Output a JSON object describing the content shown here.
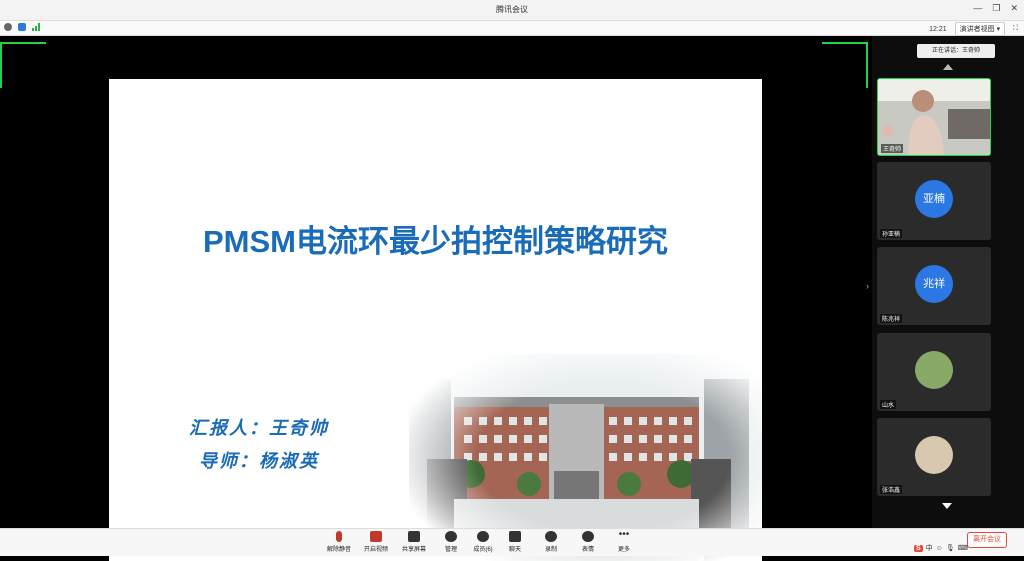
{
  "window": {
    "title": "腾讯会议"
  },
  "toolbar": {
    "time": "12:21",
    "view_label": "演讲者视图"
  },
  "slide": {
    "title": "PMSM电流环最少拍控制策略研究",
    "reporter": "汇报人：王奇帅",
    "advisor": "导师：杨淑英"
  },
  "sidebar": {
    "header": "正在讲话：王奇帅",
    "tiles": [
      {
        "name": "王奇帅",
        "avatar_text": ""
      },
      {
        "name": "孙亚楠",
        "avatar_text": "亚楠"
      },
      {
        "name": "陈兆祥",
        "avatar_text": "兆祥"
      },
      {
        "name": "山水",
        "avatar_text": ""
      },
      {
        "name": "张浩鑫",
        "avatar_text": ""
      }
    ]
  },
  "bottombar": {
    "buttons": [
      "解除静音",
      "开启视频",
      "共享屏幕",
      "管理",
      "成员(6)",
      "聊天",
      "录制",
      "表情",
      "更多"
    ],
    "leave": "离开会议"
  },
  "ime": {
    "label": "S",
    "mode": "中"
  }
}
